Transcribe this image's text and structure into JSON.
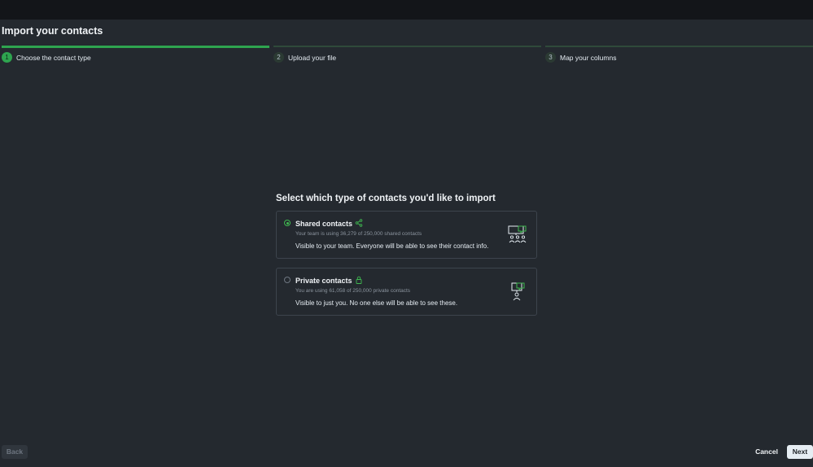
{
  "header": {
    "title": "Import your contacts"
  },
  "steps": [
    {
      "number": "1",
      "label": "Choose the contact type",
      "state": "active"
    },
    {
      "number": "2",
      "label": "Upload your file",
      "state": "upcoming"
    },
    {
      "number": "3",
      "label": "Map your columns",
      "state": "upcoming"
    }
  ],
  "main": {
    "question": "Select which type of contacts you'd like to import",
    "options": [
      {
        "title": "Shared contacts",
        "title_icon": "share-icon",
        "usage": "Your team is using 36,279 of 250,000 shared contacts",
        "description": "Visible to your team. Everyone will be able to see their contact info.",
        "illustration": "team-presentation-icon",
        "selected": true
      },
      {
        "title": "Private contacts",
        "title_icon": "lock-icon",
        "usage": "You are using 61,058 of 250,000 private contacts",
        "description": "Visible to just you. No one else will be able to see these.",
        "illustration": "person-presentation-icon",
        "selected": false
      }
    ]
  },
  "footer": {
    "back_label": "Back",
    "cancel_label": "Cancel",
    "next_label": "Next"
  },
  "colors": {
    "accent": "#2ea44f",
    "background": "#24292f",
    "topbar": "#131519"
  }
}
